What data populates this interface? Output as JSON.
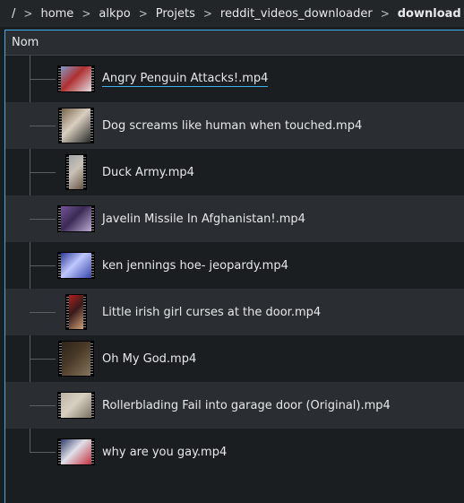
{
  "breadcrumb": {
    "items": [
      "/",
      "home",
      "alkpo",
      "Projets",
      "reddit_videos_downloader",
      "download"
    ],
    "separator": ">"
  },
  "header": {
    "name_column": "Nom"
  },
  "files": [
    {
      "name": "Angry Penguin Attacks!.mp4",
      "thumb": "wide",
      "colors": [
        "#7aa7d8",
        "#e8eef4",
        "#b03030"
      ]
    },
    {
      "name": "Dog screams like human when touched.mp4",
      "thumb": "sq",
      "colors": [
        "#6e5a3e",
        "#1a1a1a",
        "#d9cfc0"
      ]
    },
    {
      "name": "Duck Army.mp4",
      "thumb": "tall",
      "colors": [
        "#9aa0a6",
        "#5c4a3a",
        "#c9c2b5"
      ]
    },
    {
      "name": "Javelin Missile In Afghanistan!.mp4",
      "thumb": "wide",
      "colors": [
        "#7b5aa0",
        "#c8b8e0",
        "#3a2a55"
      ]
    },
    {
      "name": "ken jennings hoe- jeopardy.mp4",
      "thumb": "wide",
      "colors": [
        "#1a2a8a",
        "#2a3aa0",
        "#c0c8ff"
      ]
    },
    {
      "name": "Little irish girl curses at the door.mp4",
      "thumb": "tall",
      "colors": [
        "#c02020",
        "#e0b080",
        "#3a1a1a"
      ]
    },
    {
      "name": "Oh My God.mp4",
      "thumb": "sq",
      "colors": [
        "#2a2218",
        "#8a7a60",
        "#4a3a28"
      ]
    },
    {
      "name": "Rollerblading Fail into garage door (Original).mp4",
      "thumb": "wide",
      "colors": [
        "#b8b0a0",
        "#706858",
        "#d8d0c0"
      ]
    },
    {
      "name": "why are you gay.mp4",
      "thumb": "wide",
      "colors": [
        "#1a2a5a",
        "#c02030",
        "#e0e0e8"
      ]
    }
  ],
  "selected_index": 0,
  "colors": {
    "accent": "#3daee9",
    "background": "#1b1e20",
    "alt_row": "#2a2e32"
  }
}
